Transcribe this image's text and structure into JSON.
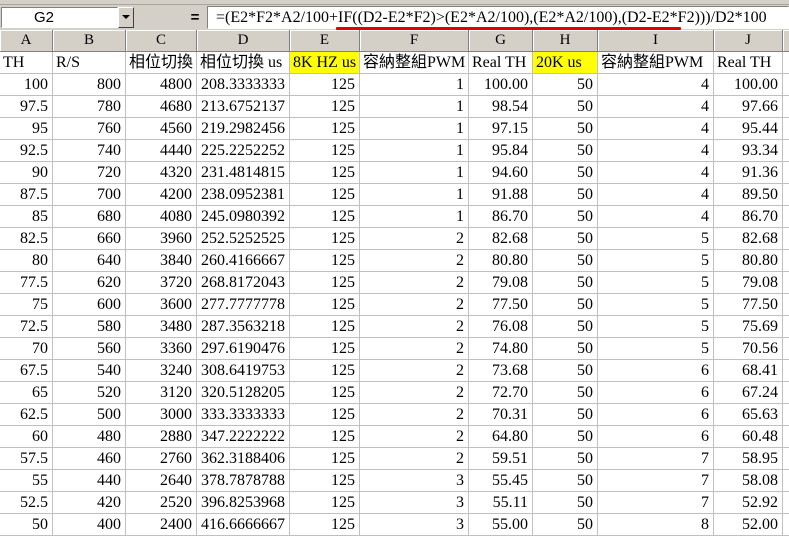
{
  "name_box": {
    "value": "G2"
  },
  "formula_bar": {
    "equals_label": "=",
    "formula": "=(E2*F2*A2/100+IF((D2-E2*F2)>(E2*A2/100),(E2*A2/100),(D2-E2*F2)))/D2*100"
  },
  "colors": {
    "annotation_mark": "#e00000"
  },
  "icons": {
    "name_box_dropdown": "down-triangle-icon"
  },
  "sheet": {
    "columns": [
      "A",
      "B",
      "C",
      "D",
      "E",
      "F",
      "G",
      "H",
      "I",
      "J"
    ],
    "header_row": [
      {
        "text": "TH"
      },
      {
        "text": "R/S"
      },
      {
        "text": "相位切換"
      },
      {
        "text": "相位切換 us"
      },
      {
        "text": "8K HZ us",
        "fill": "#ffff00"
      },
      {
        "text": "容納整組PWM"
      },
      {
        "text": "Real TH"
      },
      {
        "text": "20K us",
        "fill": "#ffff00"
      },
      {
        "text": "容納整組PWM"
      },
      {
        "text": "Real TH"
      }
    ],
    "rows": [
      [
        "100",
        "800",
        "4800",
        "208.3333333",
        "125",
        "1",
        "100.00",
        "50",
        "4",
        "100.00"
      ],
      [
        "97.5",
        "780",
        "4680",
        "213.6752137",
        "125",
        "1",
        "98.54",
        "50",
        "4",
        "97.66"
      ],
      [
        "95",
        "760",
        "4560",
        "219.2982456",
        "125",
        "1",
        "97.15",
        "50",
        "4",
        "95.44"
      ],
      [
        "92.5",
        "740",
        "4440",
        "225.2252252",
        "125",
        "1",
        "95.84",
        "50",
        "4",
        "93.34"
      ],
      [
        "90",
        "720",
        "4320",
        "231.4814815",
        "125",
        "1",
        "94.60",
        "50",
        "4",
        "91.36"
      ],
      [
        "87.5",
        "700",
        "4200",
        "238.0952381",
        "125",
        "1",
        "91.88",
        "50",
        "4",
        "89.50"
      ],
      [
        "85",
        "680",
        "4080",
        "245.0980392",
        "125",
        "1",
        "86.70",
        "50",
        "4",
        "86.70"
      ],
      [
        "82.5",
        "660",
        "3960",
        "252.5252525",
        "125",
        "2",
        "82.68",
        "50",
        "5",
        "82.68"
      ],
      [
        "80",
        "640",
        "3840",
        "260.4166667",
        "125",
        "2",
        "80.80",
        "50",
        "5",
        "80.80"
      ],
      [
        "77.5",
        "620",
        "3720",
        "268.8172043",
        "125",
        "2",
        "79.08",
        "50",
        "5",
        "79.08"
      ],
      [
        "75",
        "600",
        "3600",
        "277.7777778",
        "125",
        "2",
        "77.50",
        "50",
        "5",
        "77.50"
      ],
      [
        "72.5",
        "580",
        "3480",
        "287.3563218",
        "125",
        "2",
        "76.08",
        "50",
        "5",
        "75.69"
      ],
      [
        "70",
        "560",
        "3360",
        "297.6190476",
        "125",
        "2",
        "74.80",
        "50",
        "5",
        "70.56"
      ],
      [
        "67.5",
        "540",
        "3240",
        "308.6419753",
        "125",
        "2",
        "73.68",
        "50",
        "6",
        "68.41"
      ],
      [
        "65",
        "520",
        "3120",
        "320.5128205",
        "125",
        "2",
        "72.70",
        "50",
        "6",
        "67.24"
      ],
      [
        "62.5",
        "500",
        "3000",
        "333.3333333",
        "125",
        "2",
        "70.31",
        "50",
        "6",
        "65.63"
      ],
      [
        "60",
        "480",
        "2880",
        "347.2222222",
        "125",
        "2",
        "64.80",
        "50",
        "6",
        "60.48"
      ],
      [
        "57.5",
        "460",
        "2760",
        "362.3188406",
        "125",
        "2",
        "59.51",
        "50",
        "7",
        "58.95"
      ],
      [
        "55",
        "440",
        "2640",
        "378.7878788",
        "125",
        "3",
        "55.45",
        "50",
        "7",
        "58.08"
      ],
      [
        "52.5",
        "420",
        "2520",
        "396.8253968",
        "125",
        "3",
        "55.11",
        "50",
        "7",
        "52.92"
      ],
      [
        "50",
        "400",
        "2400",
        "416.6666667",
        "125",
        "3",
        "55.00",
        "50",
        "8",
        "52.00"
      ]
    ]
  }
}
